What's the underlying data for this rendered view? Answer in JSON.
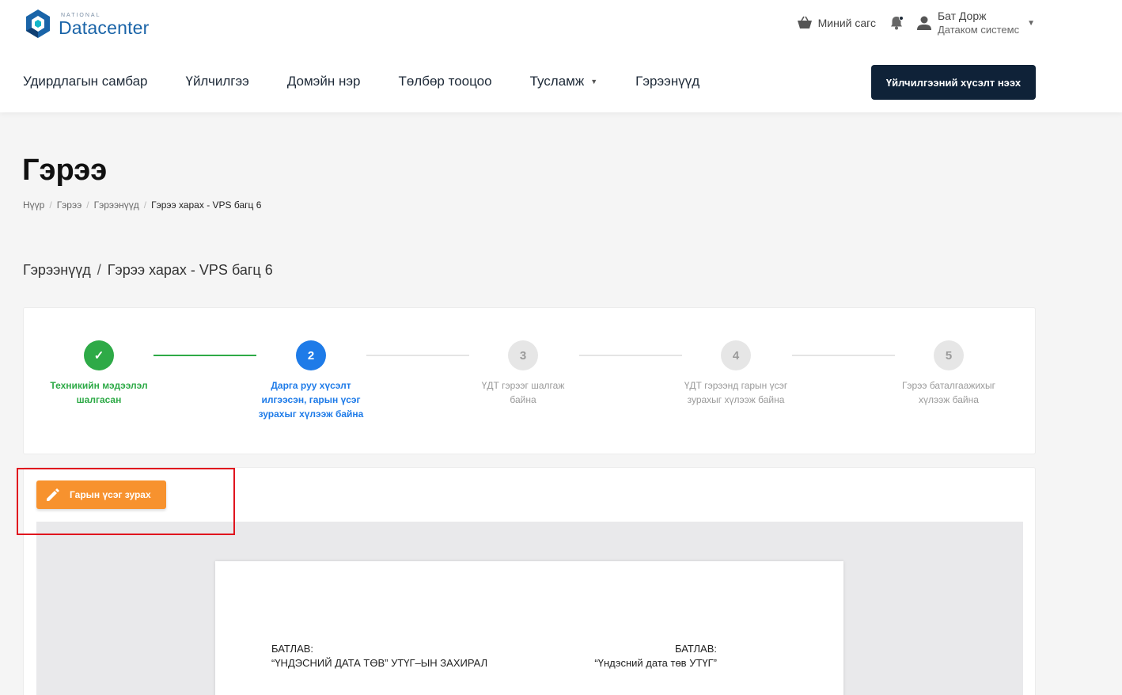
{
  "logo": {
    "small": "NATIONAL",
    "big": "Datacenter"
  },
  "header": {
    "cart_label": "Миний сагс",
    "user_name": "Бат Дорж",
    "user_company": "Датаком системс",
    "cta_label": "Үйлчилгээний хүсэлт нээх"
  },
  "nav": {
    "items": [
      "Удирдлагын самбар",
      "Үйлчилгээ",
      "Домэйн нэр",
      "Төлбөр тооцоо",
      "Тусламж",
      "Гэрээнүүд"
    ]
  },
  "page": {
    "title": "Гэрээ",
    "breadcrumb": [
      "Нүүр",
      "Гэрээ",
      "Гэрээнүүд",
      "Гэрээ харах - VPS багц 6"
    ],
    "section_title_parent": "Гэрээнүүд",
    "section_title_current": "Гэрээ харах - VPS багц 6"
  },
  "stepper": {
    "steps": [
      {
        "marker": "✓",
        "label_line1": "Техникийн мэдээлэл",
        "label_line2": "шалгасан",
        "label_line3": "",
        "status": "done"
      },
      {
        "marker": "2",
        "label_line1": "Дарга руу хүсэлт",
        "label_line2": "илгээсэн, гарын үсэг",
        "label_line3": "зурахыг хүлээж байна",
        "status": "active"
      },
      {
        "marker": "3",
        "label_line1": "ҮДТ гэрээг шалгаж",
        "label_line2": "байна",
        "label_line3": "",
        "status": "pending"
      },
      {
        "marker": "4",
        "label_line1": "ҮДТ гэрээнд гарын үсэг",
        "label_line2": "зурахыг хүлээж байна",
        "label_line3": "",
        "status": "pending"
      },
      {
        "marker": "5",
        "label_line1": "Гэрээ баталгаажихыг",
        "label_line2": "хүлээж байна",
        "label_line3": "",
        "status": "pending"
      }
    ]
  },
  "document": {
    "sign_button_label": "Гарын үсэг зурах",
    "left_approve": "БАТЛАВ:",
    "left_org": "“ҮНДЭСНИЙ ДАТА ТӨВ” УТҮГ–ЫН ЗАХИРАЛ",
    "right_approve": "БАТЛАВ:",
    "right_org": "“Үндэсний дата төв УТҮГ”"
  },
  "colors": {
    "done": "#2eaa47",
    "active": "#1e7be8",
    "pending": "#e6e6e6",
    "sign_button": "#f7922e",
    "cta": "#0f2238",
    "highlight": "#e0141e"
  }
}
